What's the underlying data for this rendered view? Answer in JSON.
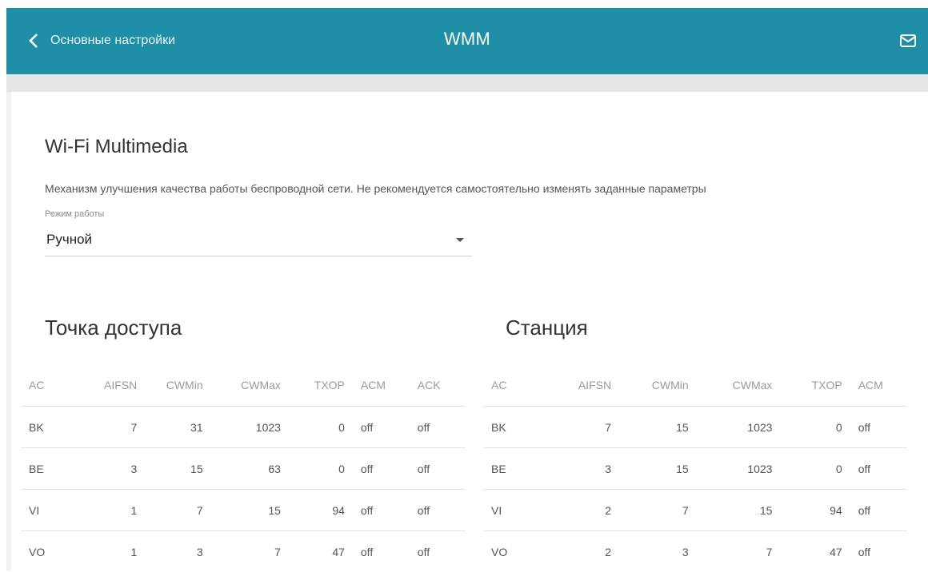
{
  "header": {
    "back_label": "Основные настройки",
    "title": "WMM"
  },
  "main": {
    "section_title": "Wi-Fi Multimedia",
    "description": "Механизм улучшения качества работы беспроводной сети. Не рекомендуется самостоятельно изменять заданные параметры",
    "mode": {
      "label": "Режим работы",
      "value": "Ручной"
    }
  },
  "access_point": {
    "title": "Точка доступа",
    "columns": [
      "AC",
      "AIFSN",
      "CWMin",
      "CWMax",
      "TXOP",
      "ACM",
      "ACK"
    ],
    "rows": [
      [
        "BK",
        "7",
        "31",
        "1023",
        "0",
        "off",
        "off"
      ],
      [
        "BE",
        "3",
        "15",
        "63",
        "0",
        "off",
        "off"
      ],
      [
        "VI",
        "1",
        "7",
        "15",
        "94",
        "off",
        "off"
      ],
      [
        "VO",
        "1",
        "3",
        "7",
        "47",
        "off",
        "off"
      ]
    ]
  },
  "station": {
    "title": "Станция",
    "columns": [
      "AC",
      "AIFSN",
      "CWMin",
      "CWMax",
      "TXOP",
      "ACM"
    ],
    "rows": [
      [
        "BK",
        "7",
        "15",
        "1023",
        "0",
        "off"
      ],
      [
        "BE",
        "3",
        "15",
        "1023",
        "0",
        "off"
      ],
      [
        "VI",
        "2",
        "7",
        "15",
        "94",
        "off"
      ],
      [
        "VO",
        "2",
        "3",
        "7",
        "47",
        "off"
      ]
    ]
  },
  "icons": {
    "back": "chevron-left-icon",
    "mail": "mail-icon",
    "dropdown": "caret-down-icon"
  },
  "colors": {
    "header": "#1f8fa8"
  }
}
